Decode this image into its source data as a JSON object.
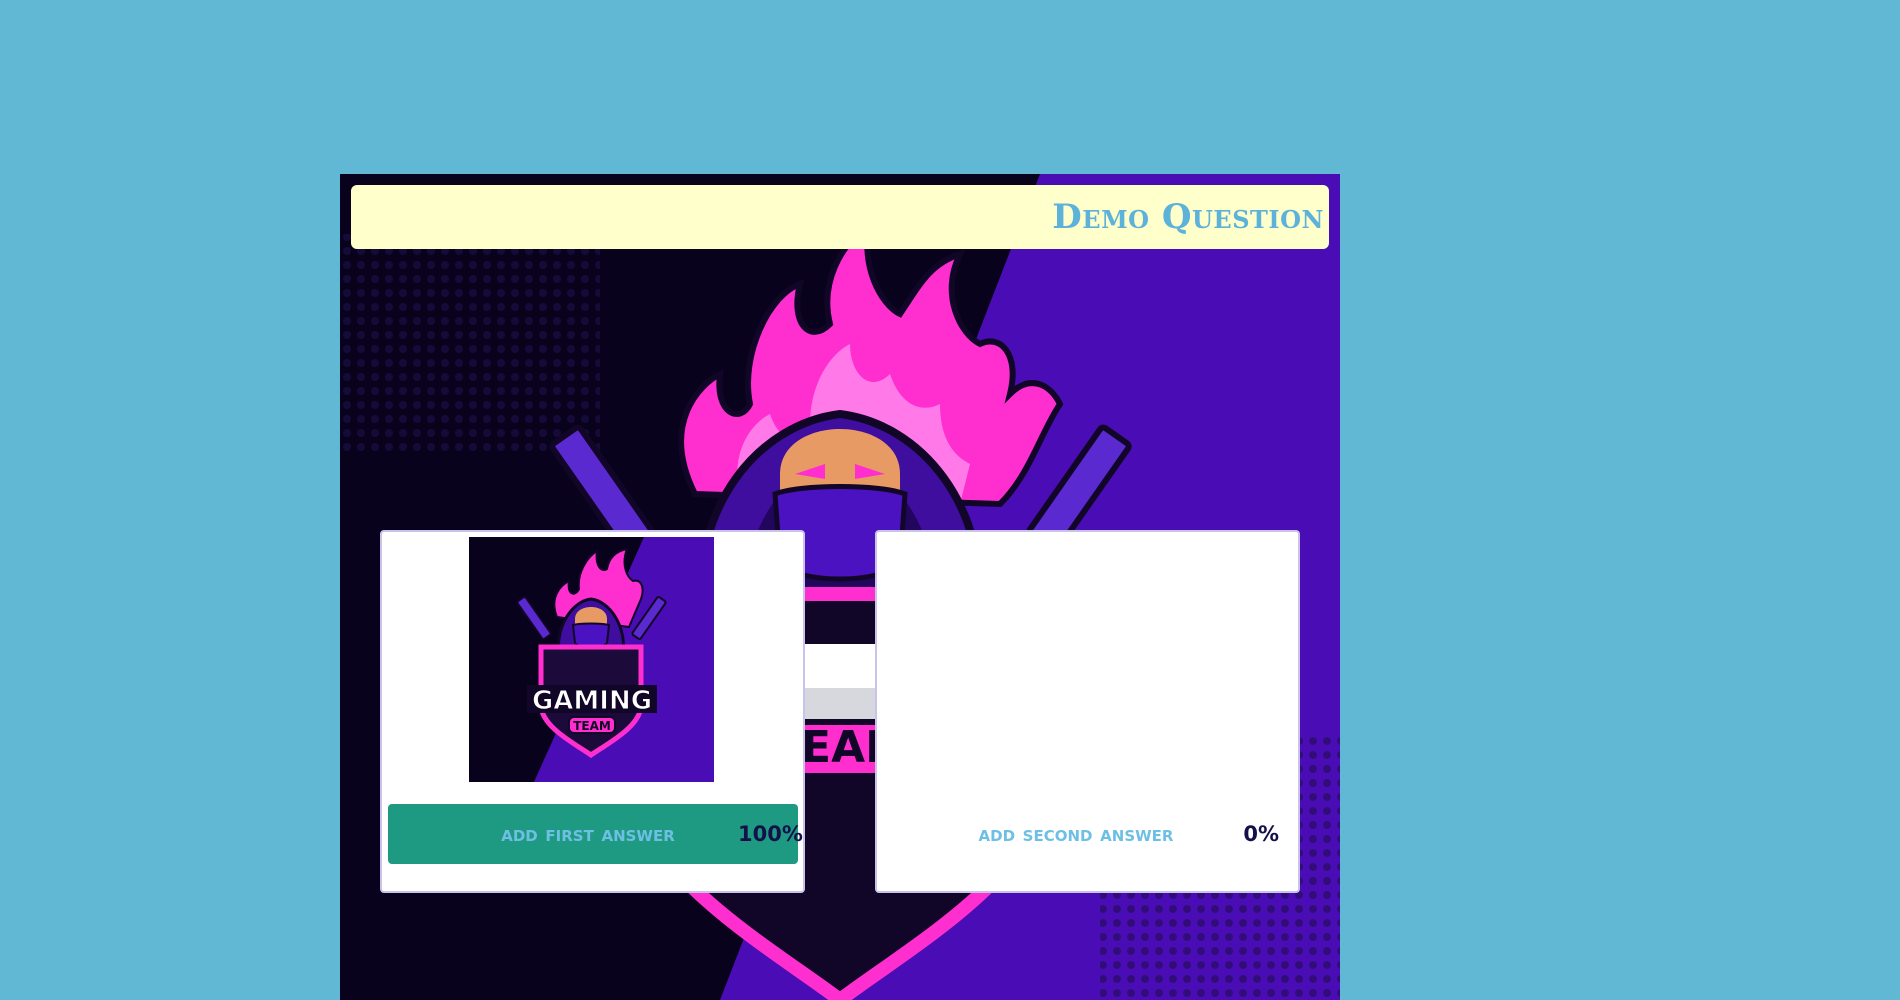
{
  "question": {
    "title": "Demo Question"
  },
  "answers": [
    {
      "label": "add first answer",
      "percent": "100%",
      "has_image": true,
      "image_alt": "gaming-team-logo"
    },
    {
      "label": "add second answer",
      "percent": "0%",
      "has_image": false
    }
  ],
  "background_logo": {
    "icon": "gaming-team-logo",
    "text_top": "GAMING",
    "text_bottom": "TEAM"
  },
  "colors": {
    "page_background": "#60b8d4",
    "question_bar": "#ffffcc",
    "question_text": "#5db2da",
    "selected_answer": "#1f9a82",
    "answer_text": "#6ebfe4",
    "percent_text": "#14104a",
    "accent_pink": "#ff2fcf",
    "accent_purple": "#4a0fb8"
  }
}
